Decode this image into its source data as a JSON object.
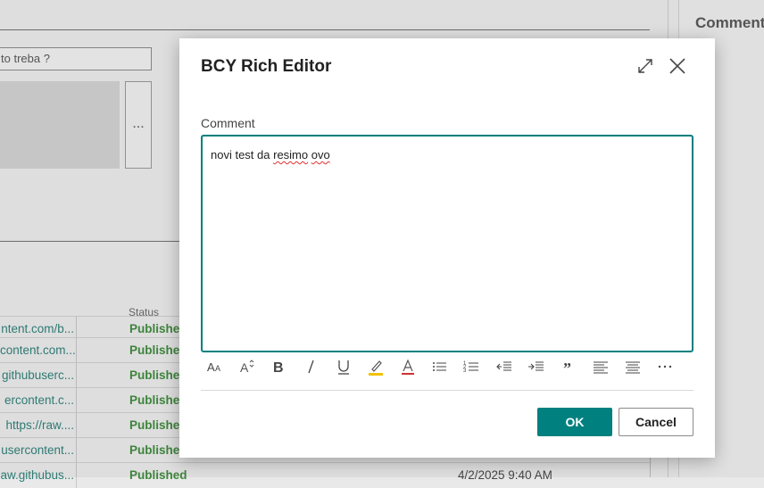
{
  "background": {
    "search_input_value": "to treba ?",
    "more_button_label": "...",
    "status_header": "Status",
    "right_panel_title": "Comment",
    "rows": [
      {
        "url": "ntent.com/b...",
        "status": "Published",
        "date": ""
      },
      {
        "url": "content.com...",
        "status": "Published",
        "date": ""
      },
      {
        "url": "githubuserc...",
        "status": "Published",
        "date": ""
      },
      {
        "url": "ercontent.c...",
        "status": "Published",
        "date": ""
      },
      {
        "url": "https://raw....",
        "status": "Published",
        "date": ""
      },
      {
        "url": "usercontent...",
        "status": "Published",
        "date": ""
      },
      {
        "url": "aw.githubus...",
        "status": "Published",
        "date": "4/2/2025 9:40 AM"
      }
    ]
  },
  "dialog": {
    "title": "BCY Rich Editor",
    "field_label": "Comment",
    "editor_text_plain": "novi test da ",
    "editor_text_misspelled_1": "resimo",
    "editor_text_space": " ",
    "editor_text_misspelled_2": "ovo",
    "toolbar": [
      {
        "name": "font-size-icon"
      },
      {
        "name": "font-style-icon"
      },
      {
        "name": "bold-icon"
      },
      {
        "name": "italic-icon"
      },
      {
        "name": "underline-icon"
      },
      {
        "name": "highlight-icon"
      },
      {
        "name": "font-color-icon"
      },
      {
        "name": "bullet-list-icon"
      },
      {
        "name": "numbered-list-icon"
      },
      {
        "name": "decrease-indent-icon"
      },
      {
        "name": "increase-indent-icon"
      },
      {
        "name": "quote-icon"
      },
      {
        "name": "align-left-icon"
      },
      {
        "name": "align-center-icon"
      },
      {
        "name": "more-icon"
      }
    ],
    "ok_label": "OK",
    "cancel_label": "Cancel"
  },
  "colors": {
    "accent": "#00807f",
    "status_green": "#3c8a3a",
    "link_teal": "#2a7f78",
    "highlight_yellow": "#f2c200",
    "font_color_red": "#d03030"
  }
}
